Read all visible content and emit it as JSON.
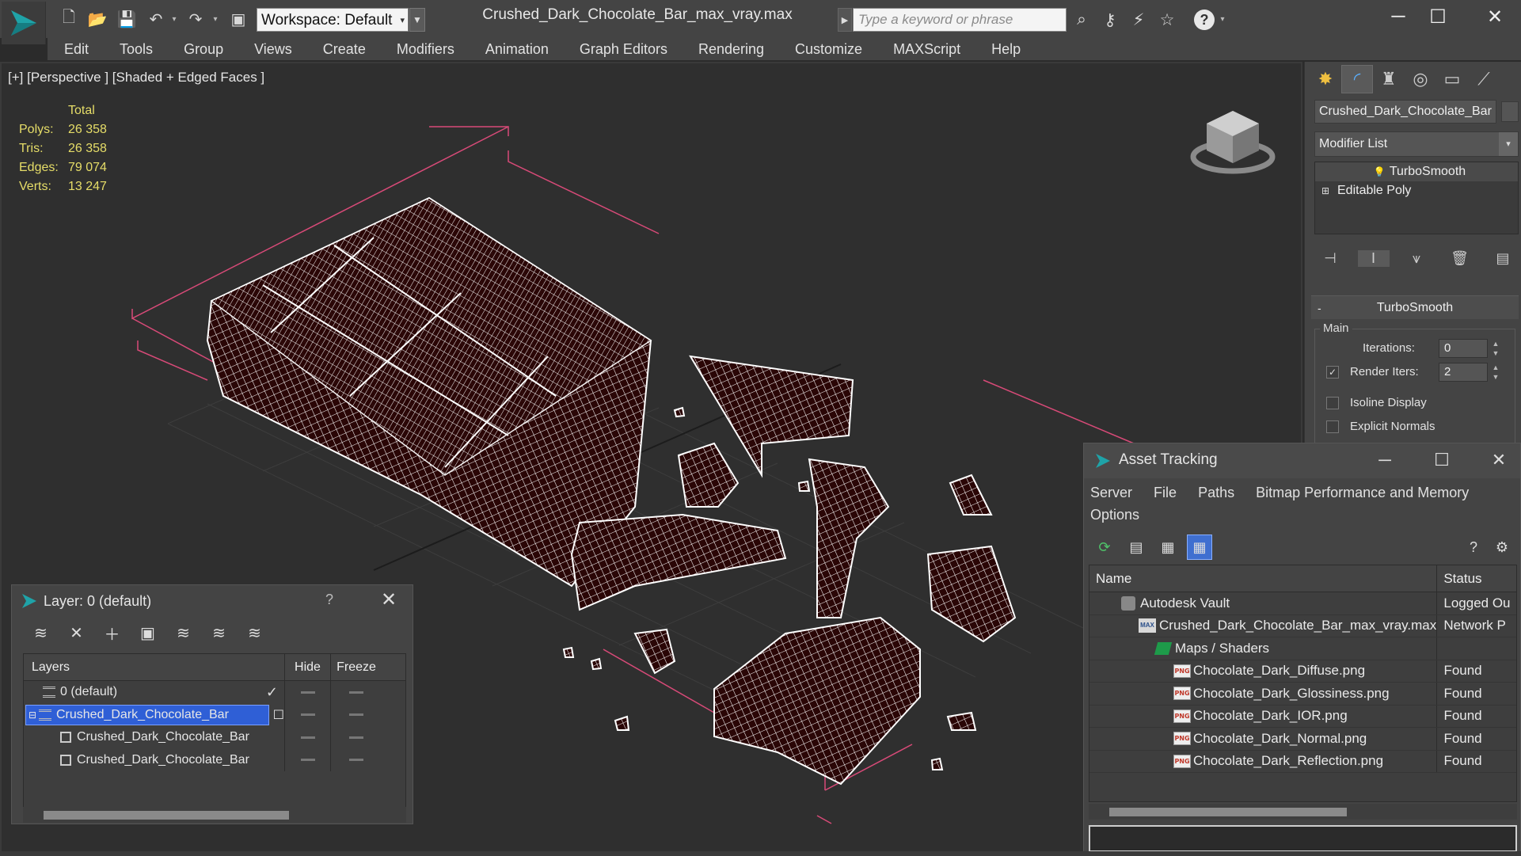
{
  "window": {
    "title": "Crushed_Dark_Chocolate_Bar_max_vray.max",
    "workspace_label": "Workspace: Default",
    "search_placeholder": "Type a keyword or phrase"
  },
  "menu": [
    "Edit",
    "Tools",
    "Group",
    "Views",
    "Create",
    "Modifiers",
    "Animation",
    "Graph Editors",
    "Rendering",
    "Customize",
    "MAXScript",
    "Help"
  ],
  "viewport": {
    "label": "[+] [Perspective ] [Shaded + Edged Faces ]",
    "stats": {
      "header": "Total",
      "rows": [
        {
          "k": "Polys:",
          "v": "26 358"
        },
        {
          "k": "Tris:",
          "v": "26 358"
        },
        {
          "k": "Edges:",
          "v": "79 074"
        },
        {
          "k": "Verts:",
          "v": "13 247"
        }
      ]
    }
  },
  "command_panel": {
    "object_name": "Crushed_Dark_Chocolate_Bar",
    "modifier_list": "Modifier List",
    "stack": [
      "TurboSmooth",
      "Editable Poly"
    ],
    "rollout_title": "TurboSmooth",
    "group_label": "Main",
    "iterations_label": "Iterations:",
    "iterations_value": "0",
    "render_iters_label": "Render Iters:",
    "render_iters_value": "2",
    "isoline_label": "Isoline Display",
    "explicit_normals_label": "Explicit Normals"
  },
  "asset_tracking": {
    "title": "Asset Tracking",
    "menu": [
      "Server",
      "File",
      "Paths",
      "Bitmap Performance and Memory",
      "Options"
    ],
    "columns": [
      "Name",
      "Status"
    ],
    "rows": [
      {
        "name": "Autodesk Vault",
        "status": "Logged Ou",
        "indent": 1,
        "icon": "vault"
      },
      {
        "name": "Crushed_Dark_Chocolate_Bar_max_vray.max",
        "status": "Network P",
        "indent": 2,
        "icon": "max"
      },
      {
        "name": "Maps / Shaders",
        "status": "",
        "indent": 3,
        "icon": "folder"
      },
      {
        "name": "Chocolate_Dark_Diffuse.png",
        "status": "Found",
        "indent": 4,
        "icon": "png"
      },
      {
        "name": "Chocolate_Dark_Glossiness.png",
        "status": "Found",
        "indent": 4,
        "icon": "png"
      },
      {
        "name": "Chocolate_Dark_IOR.png",
        "status": "Found",
        "indent": 4,
        "icon": "png"
      },
      {
        "name": "Chocolate_Dark_Normal.png",
        "status": "Found",
        "indent": 4,
        "icon": "png"
      },
      {
        "name": "Chocolate_Dark_Reflection.png",
        "status": "Found",
        "indent": 4,
        "icon": "png"
      }
    ]
  },
  "layer_explorer": {
    "title": "Layer: 0 (default)",
    "help": "?",
    "columns": [
      "Layers",
      "Hide",
      "Freeze"
    ],
    "rows": [
      {
        "name": "0 (default)",
        "level": 1,
        "icon": "layer",
        "selected": false,
        "current": true
      },
      {
        "name": "Crushed_Dark_Chocolate_Bar",
        "level": 0,
        "icon": "layer",
        "selected": true,
        "current": false
      },
      {
        "name": "Crushed_Dark_Chocolate_Bar",
        "level": 2,
        "icon": "object",
        "selected": false,
        "current": false
      },
      {
        "name": "Crushed_Dark_Chocolate_Bar",
        "level": 2,
        "icon": "object",
        "selected": false,
        "current": false
      }
    ]
  },
  "colors": {
    "ui_dark": "#444444",
    "viewport_bg": "#2f2f2f",
    "stats_yellow": "#e6dd68",
    "wireframe": "#ffffff",
    "mesh_fill": "#2a0606",
    "bbox_pink": "#d84a78",
    "selection_blue": "#2f5fd6"
  }
}
